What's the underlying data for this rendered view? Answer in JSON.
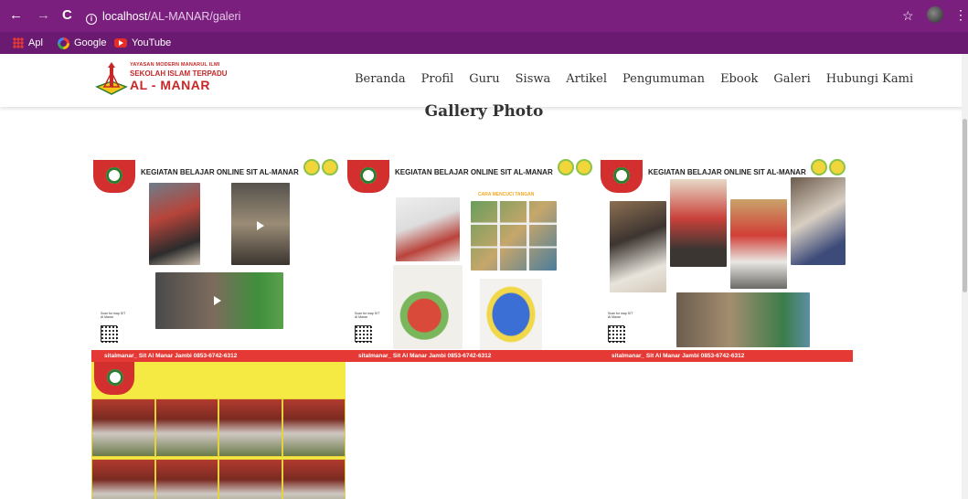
{
  "browser": {
    "url_host": "localhost",
    "url_path": "/AL-MANAR/galeri",
    "bookmarks": [
      {
        "label": "Apl",
        "icon": "apps-icon"
      },
      {
        "label": "Google",
        "icon": "google-icon"
      },
      {
        "label": "YouTube",
        "icon": "youtube-icon"
      }
    ]
  },
  "site": {
    "logo": {
      "line1": "YAYASAN MODERN MANARUL ILMI",
      "line2": "SEKOLAH ISLAM TERPADU",
      "line3": "AL - MANAR"
    },
    "nav": [
      "Beranda",
      "Profil",
      "Guru",
      "Siswa",
      "Artikel",
      "Pengumuman",
      "Ebook",
      "Galeri",
      "Hubungi Kami"
    ]
  },
  "gallery": {
    "title": "Gallery Photo",
    "cards": [
      {
        "title": "KEGIATAN BELAJAR ONLINE SIT AL-MANAR",
        "footer": "sitalmanar_   Sit Al Manar Jambi   0853-6742-6312",
        "qr_label": "Scan for map SIT Al Manar"
      },
      {
        "title": "KEGIATAN BELAJAR ONLINE SIT AL-MANAR",
        "footer": "sitalmanar_   Sit Al Manar Jambi   0853-6742-6312",
        "qr_label": "Scan for map SIT Al Manar",
        "caption": "CARA MENCUCI TANGAN"
      },
      {
        "title": "KEGIATAN BELAJAR ONLINE SIT AL-MANAR",
        "footer": "sitalmanar_   Sit Al Manar Jambi   0853-6742-6312",
        "qr_label": "Scan for map SIT Al Manar"
      }
    ]
  },
  "colors": {
    "chrome": "#7b1f7f",
    "accent": "#c62828",
    "card_bar": "#e53935"
  }
}
